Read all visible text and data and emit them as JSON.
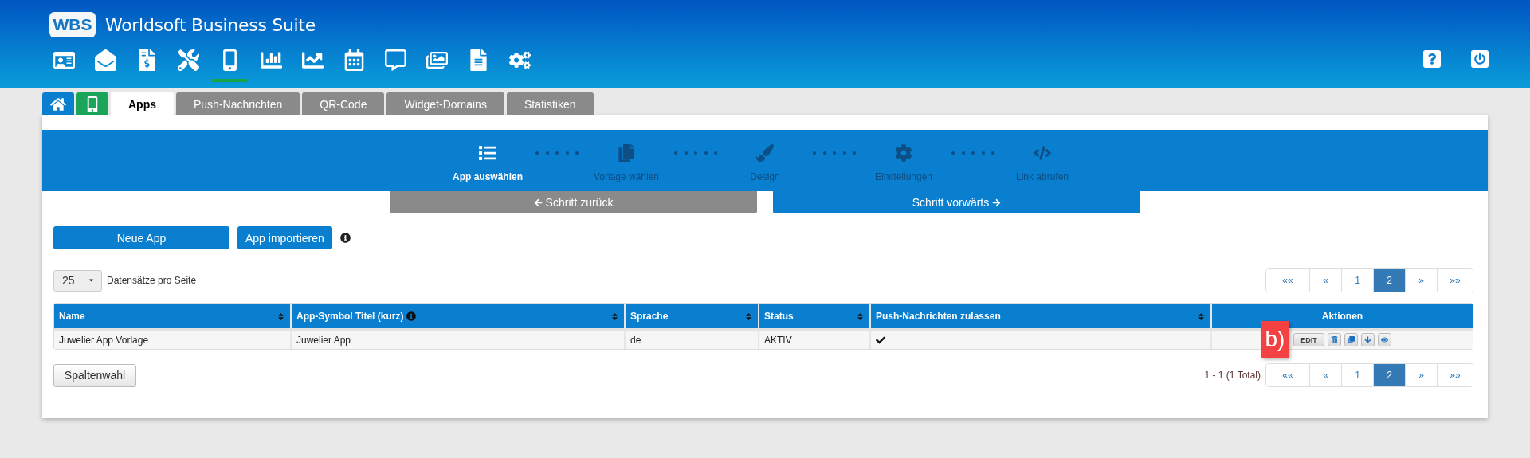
{
  "header": {
    "logo": "WBS",
    "title": "Worldsoft Business Suite",
    "nav_icons": [
      {
        "kind": "idcard",
        "selected": false
      },
      {
        "kind": "mail",
        "selected": false
      },
      {
        "kind": "invoice",
        "selected": false
      },
      {
        "kind": "tools",
        "selected": false
      },
      {
        "kind": "mobile",
        "selected": true
      },
      {
        "kind": "barchart",
        "selected": false
      },
      {
        "kind": "linechart",
        "selected": false
      },
      {
        "kind": "calendar",
        "selected": false
      },
      {
        "kind": "comment",
        "selected": false
      },
      {
        "kind": "images",
        "selected": false
      },
      {
        "kind": "document",
        "selected": false
      },
      {
        "kind": "cogs",
        "selected": false
      }
    ],
    "right_icons": [
      {
        "kind": "help"
      },
      {
        "kind": "power"
      }
    ]
  },
  "tabs": [
    {
      "kind": "home",
      "selected": false
    },
    {
      "kind": "app",
      "selected": false
    },
    {
      "kind": "text",
      "label": "Apps",
      "selected": true
    },
    {
      "kind": "text",
      "label": "Push-Nachrichten",
      "selected": false
    },
    {
      "kind": "text",
      "label": "QR-Code",
      "selected": false
    },
    {
      "kind": "text",
      "label": "Widget-Domains",
      "selected": false
    },
    {
      "kind": "text",
      "label": "Statistiken",
      "selected": false
    }
  ],
  "steps": [
    {
      "kind": "list",
      "label": "App auswählen",
      "selected": true
    },
    {
      "kind": "files",
      "label": "Vorlage wählen",
      "selected": false
    },
    {
      "kind": "brush",
      "label": "Design",
      "selected": false
    },
    {
      "kind": "cog",
      "label": "Einstellungen",
      "selected": false
    },
    {
      "kind": "code",
      "label": "Link abrufen",
      "selected": false
    }
  ],
  "step_buttons": [
    {
      "kind": "back",
      "label": "Schritt zurück",
      "disabled": true
    },
    {
      "kind": "forward",
      "label": "Schritt vorwärts",
      "disabled": false
    }
  ],
  "actions": {
    "new_app": "Neue App",
    "import_app": "App importieren"
  },
  "page_size": {
    "value": "25",
    "label": "Datensätze pro Seite"
  },
  "pagination_top": [
    {
      "label": "««",
      "selected": false
    },
    {
      "label": "«",
      "selected": false
    },
    {
      "label": "1",
      "selected": false
    },
    {
      "label": "2",
      "selected": true
    },
    {
      "label": "»",
      "selected": false
    },
    {
      "label": "»»",
      "selected": false
    }
  ],
  "table": {
    "columns": [
      {
        "label": "Name",
        "sortable": true,
        "info": false
      },
      {
        "label": "App-Symbol Titel (kurz)",
        "sortable": true,
        "info": true
      },
      {
        "label": "Sprache",
        "sortable": true,
        "info": false
      },
      {
        "label": "Status",
        "sortable": true,
        "info": false
      },
      {
        "label": "Push-Nachrichten zulassen",
        "sortable": true,
        "info": false
      },
      {
        "label": "Aktionen",
        "sortable": false,
        "info": false
      }
    ],
    "rows": [
      {
        "name": "Juwelier App Vorlage",
        "title": "Juwelier App",
        "language": "de",
        "status": "AKTIV",
        "push_allowed": true,
        "edit": "EDIT",
        "row_actions": [
          {
            "kind": "delete"
          },
          {
            "kind": "copy"
          },
          {
            "kind": "download"
          },
          {
            "kind": "view"
          }
        ]
      }
    ]
  },
  "column_choice": "Spaltenwahl",
  "total": "1 - 1 (1 Total)",
  "pagination_bottom": [
    {
      "label": "««",
      "selected": false
    },
    {
      "label": "«",
      "selected": false
    },
    {
      "label": "1",
      "selected": false
    },
    {
      "label": "2",
      "selected": true
    },
    {
      "label": "»",
      "selected": false
    },
    {
      "label": "»»",
      "selected": false
    }
  ],
  "annotation": {
    "text": "b)"
  }
}
